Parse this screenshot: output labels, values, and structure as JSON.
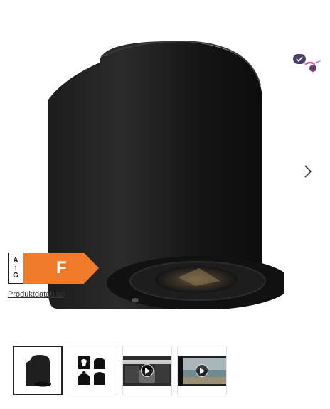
{
  "gallery": {
    "main_image_alt": "Black cylindrical outdoor wall light",
    "next_label": "›",
    "active_index": 0
  },
  "energy_label": {
    "scale_top": "A",
    "scale_bottom": "G",
    "energy_class": "F",
    "class_color": "#f07b2b",
    "datasheet_link": "Produktdatablad"
  },
  "badges": {
    "check_icon": "checkmark-badge-icon",
    "brush_icon": "brush-badge-icon"
  },
  "thumbnails": [
    {
      "type": "image",
      "icon": "lamp-thumbnail"
    },
    {
      "type": "image",
      "icon": "light-pattern-icons"
    },
    {
      "type": "video",
      "icon": "play-icon"
    },
    {
      "type": "video",
      "icon": "play-icon"
    }
  ]
}
